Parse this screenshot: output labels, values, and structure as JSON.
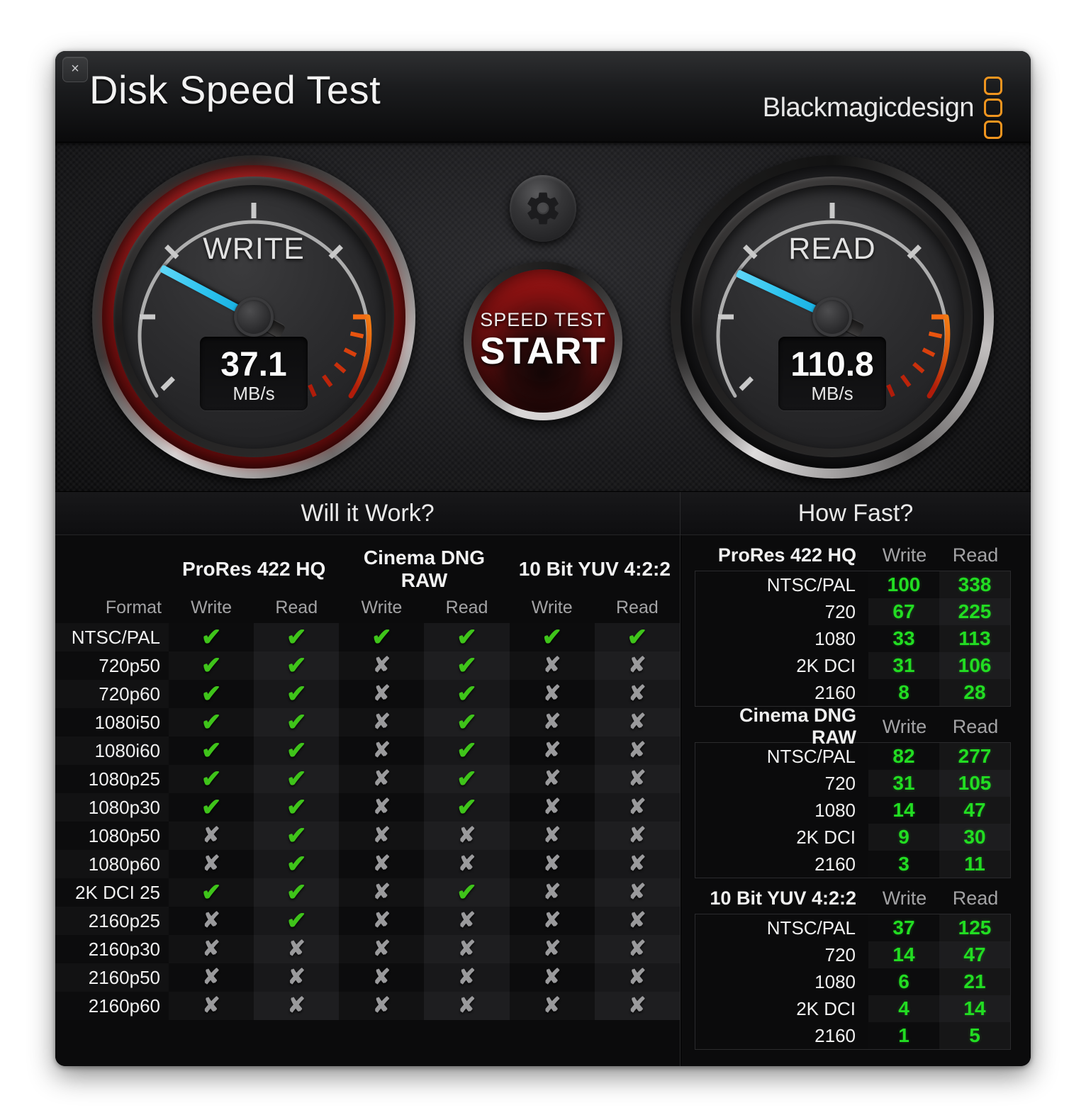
{
  "window": {
    "title": "Disk Speed Test",
    "close_label": "×",
    "brand": "Blackmagicdesign"
  },
  "gauges": {
    "write": {
      "label": "WRITE",
      "value": "37.1",
      "unit": "MB/s",
      "numeric": 37.1
    },
    "read": {
      "label": "READ",
      "value": "110.8",
      "unit": "MB/s",
      "numeric": 110.8
    }
  },
  "controls": {
    "gear_icon": "gear-icon",
    "start_sub": "SPEED TEST",
    "start_main": "START"
  },
  "will_it_work": {
    "title": "Will it Work?",
    "group_headers": [
      "ProRes 422 HQ",
      "Cinema DNG RAW",
      "10 Bit YUV 4:2:2"
    ],
    "sub_headers": [
      "Format",
      "Write",
      "Read",
      "Write",
      "Read",
      "Write",
      "Read"
    ],
    "rows": [
      {
        "format": "NTSC/PAL",
        "cells": [
          true,
          true,
          true,
          true,
          true,
          true
        ]
      },
      {
        "format": "720p50",
        "cells": [
          true,
          true,
          false,
          true,
          false,
          false
        ]
      },
      {
        "format": "720p60",
        "cells": [
          true,
          true,
          false,
          true,
          false,
          false
        ]
      },
      {
        "format": "1080i50",
        "cells": [
          true,
          true,
          false,
          true,
          false,
          false
        ]
      },
      {
        "format": "1080i60",
        "cells": [
          true,
          true,
          false,
          true,
          false,
          false
        ]
      },
      {
        "format": "1080p25",
        "cells": [
          true,
          true,
          false,
          true,
          false,
          false
        ]
      },
      {
        "format": "1080p30",
        "cells": [
          true,
          true,
          false,
          true,
          false,
          false
        ]
      },
      {
        "format": "1080p50",
        "cells": [
          false,
          true,
          false,
          false,
          false,
          false
        ]
      },
      {
        "format": "1080p60",
        "cells": [
          false,
          true,
          false,
          false,
          false,
          false
        ]
      },
      {
        "format": "2K DCI 25",
        "cells": [
          true,
          true,
          false,
          true,
          false,
          false
        ]
      },
      {
        "format": "2160p25",
        "cells": [
          false,
          true,
          false,
          false,
          false,
          false
        ]
      },
      {
        "format": "2160p30",
        "cells": [
          false,
          false,
          false,
          false,
          false,
          false
        ]
      },
      {
        "format": "2160p50",
        "cells": [
          false,
          false,
          false,
          false,
          false,
          false
        ]
      },
      {
        "format": "2160p60",
        "cells": [
          false,
          false,
          false,
          false,
          false,
          false
        ]
      }
    ],
    "ok_glyph": "✔",
    "no_glyph": "✘"
  },
  "how_fast": {
    "title": "How Fast?",
    "col_write": "Write",
    "col_read": "Read",
    "groups": [
      {
        "name": "ProRes 422 HQ",
        "rows": [
          {
            "name": "NTSC/PAL",
            "write": "100",
            "read": "338"
          },
          {
            "name": "720",
            "write": "67",
            "read": "225"
          },
          {
            "name": "1080",
            "write": "33",
            "read": "113"
          },
          {
            "name": "2K DCI",
            "write": "31",
            "read": "106"
          },
          {
            "name": "2160",
            "write": "8",
            "read": "28"
          }
        ]
      },
      {
        "name": "Cinema DNG RAW",
        "rows": [
          {
            "name": "NTSC/PAL",
            "write": "82",
            "read": "277"
          },
          {
            "name": "720",
            "write": "31",
            "read": "105"
          },
          {
            "name": "1080",
            "write": "14",
            "read": "47"
          },
          {
            "name": "2K DCI",
            "write": "9",
            "read": "30"
          },
          {
            "name": "2160",
            "write": "3",
            "read": "11"
          }
        ]
      },
      {
        "name": "10 Bit YUV 4:2:2",
        "rows": [
          {
            "name": "NTSC/PAL",
            "write": "37",
            "read": "125"
          },
          {
            "name": "720",
            "write": "14",
            "read": "47"
          },
          {
            "name": "1080",
            "write": "6",
            "read": "21"
          },
          {
            "name": "2K DCI",
            "write": "4",
            "read": "14"
          },
          {
            "name": "2160",
            "write": "1",
            "read": "5"
          }
        ]
      }
    ]
  },
  "colors": {
    "accent_orange": "#f0951f",
    "value_green": "#22dd22",
    "needle_blue": "#2fc4ef",
    "check_green": "#3fc41a",
    "cross_grey": "#9a9a9c"
  }
}
